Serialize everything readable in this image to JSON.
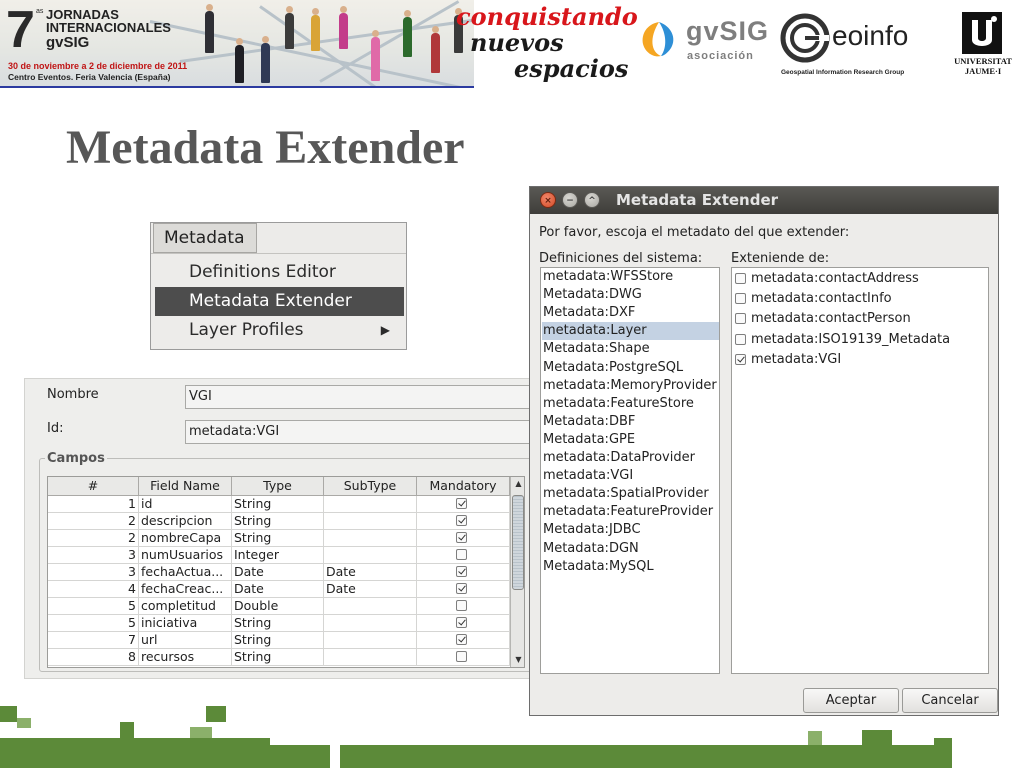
{
  "banner": {
    "edition_number": "7",
    "edition_suffix": "as",
    "event_line1": "JORNADAS",
    "event_line2": "INTERNACIONALES",
    "event_line3": "gvSIG",
    "dates": "30 de noviembre a 2 de diciembre de 2011",
    "venue": "Centro Eventos. Feria Valencia (España)",
    "slogan_line1": "conquistando",
    "slogan_line2": "nuevos",
    "slogan_line3": "espacios",
    "gvsig_logo_text": "gvSIG",
    "gvsig_logo_sub": "asociación",
    "geoinfo_text": "eoinfo",
    "geoinfo_sub": "Geospatial Information Research Group",
    "uji_line1": "UNIVERSITAT",
    "uji_line2": "JAUME·I"
  },
  "slide": {
    "title": "Metadata Extender"
  },
  "menu": {
    "title": "Metadata",
    "items": [
      {
        "label": "Definitions Editor"
      },
      {
        "label": "Metadata Extender"
      },
      {
        "label": "Layer Profiles",
        "submenu_arrow": "▶"
      }
    ]
  },
  "form": {
    "nombre_label": "Nombre",
    "nombre_value": "VGI",
    "id_label": "Id:",
    "id_value": "metadata:VGI",
    "campos_label": "Campos",
    "columns": [
      "#",
      "Field Name",
      "Type",
      "SubType",
      "Mandatory"
    ],
    "rows": [
      {
        "num": "1",
        "name": "id",
        "type": "String",
        "subtype": "",
        "mandatory": true
      },
      {
        "num": "2",
        "name": "descripcion",
        "type": "String",
        "subtype": "",
        "mandatory": true
      },
      {
        "num": "2",
        "name": "nombreCapa",
        "type": "String",
        "subtype": "",
        "mandatory": true
      },
      {
        "num": "3",
        "name": "numUsuarios",
        "type": "Integer",
        "subtype": "",
        "mandatory": false
      },
      {
        "num": "3",
        "name": "fechaActua...",
        "type": "Date",
        "subtype": "Date",
        "mandatory": true
      },
      {
        "num": "4",
        "name": "fechaCreac...",
        "type": "Date",
        "subtype": "Date",
        "mandatory": true
      },
      {
        "num": "5",
        "name": "completitud",
        "type": "Double",
        "subtype": "",
        "mandatory": false
      },
      {
        "num": "5",
        "name": "iniciativa",
        "type": "String",
        "subtype": "",
        "mandatory": true
      },
      {
        "num": "7",
        "name": "url",
        "type": "String",
        "subtype": "",
        "mandatory": true
      },
      {
        "num": "8",
        "name": "recursos",
        "type": "String",
        "subtype": "",
        "mandatory": false
      }
    ]
  },
  "dialog": {
    "title": "Metadata Extender",
    "prompt": "Por favor, escoja el metadato del que extender:",
    "definitions_label": "Definiciones del sistema:",
    "extends_label": "Exteniende de:",
    "definitions": [
      "metadata:WFSStore",
      "Metadata:DWG",
      "Metadata:DXF",
      "metadata:Layer",
      "Metadata:Shape",
      "Metadata:PostgreSQL",
      "metadata:MemoryProvider",
      "metadata:FeatureStore",
      "Metadata:DBF",
      "Metadata:GPE",
      "metadata:DataProvider",
      "metadata:VGI",
      "metadata:SpatialProvider",
      "metadata:FeatureProvider",
      "Metadata:JDBC",
      "Metadata:DGN",
      "Metadata:MySQL"
    ],
    "selected_definition": "metadata:Layer",
    "extends": [
      {
        "label": "metadata:contactAddress",
        "checked": false
      },
      {
        "label": "metadata:contactInfo",
        "checked": false
      },
      {
        "label": "metadata:contactPerson",
        "checked": false
      },
      {
        "label": "metadata:ISO19139_Metadata",
        "checked": false
      },
      {
        "label": "metadata:VGI",
        "checked": true
      }
    ],
    "accept_label": "Aceptar",
    "cancel_label": "Cancelar"
  },
  "colors": {
    "title_gray": "#575757",
    "menu_selected": "#4d4d4d",
    "list_selected": "#c4d2e3",
    "deco_green": "#5c8a39",
    "slogan_red": "#d8161b"
  }
}
